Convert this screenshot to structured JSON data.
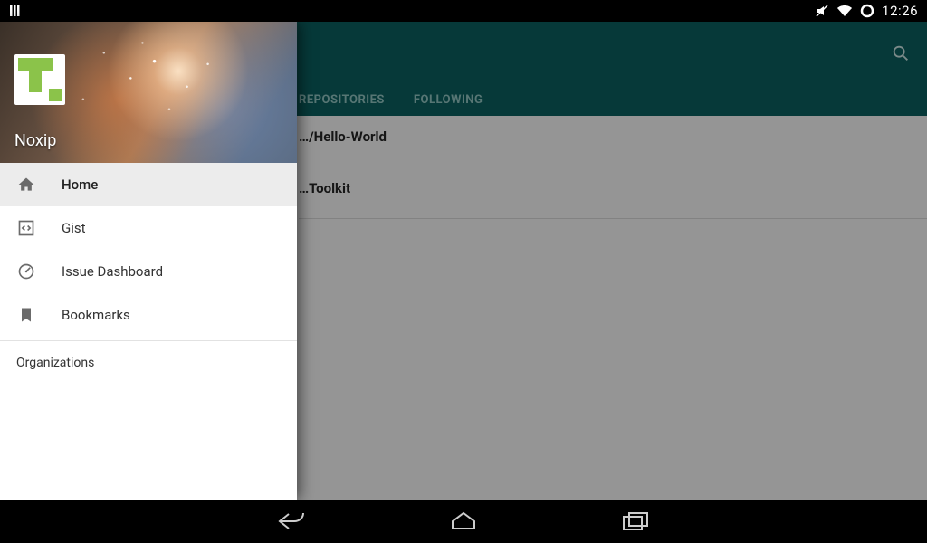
{
  "statusbar": {
    "time": "12:26"
  },
  "actionbar": {
    "tabs": [
      {
        "id": "repositories",
        "label": "REPOSITORIES"
      },
      {
        "id": "following",
        "label": "FOLLOWING"
      }
    ],
    "active_tab": 0
  },
  "repos": [
    {
      "name": "…/Hello-World",
      "desc": ""
    },
    {
      "name": "…Toolkit",
      "desc": ""
    }
  ],
  "drawer": {
    "username": "Noxip",
    "items": [
      {
        "icon": "home-icon",
        "label": "Home",
        "selected": true
      },
      {
        "icon": "gist-icon",
        "label": "Gist",
        "selected": false
      },
      {
        "icon": "dashboard-icon",
        "label": "Issue Dashboard",
        "selected": false
      },
      {
        "icon": "bookmark-icon",
        "label": "Bookmarks",
        "selected": false
      }
    ],
    "section_label": "Organizations"
  }
}
